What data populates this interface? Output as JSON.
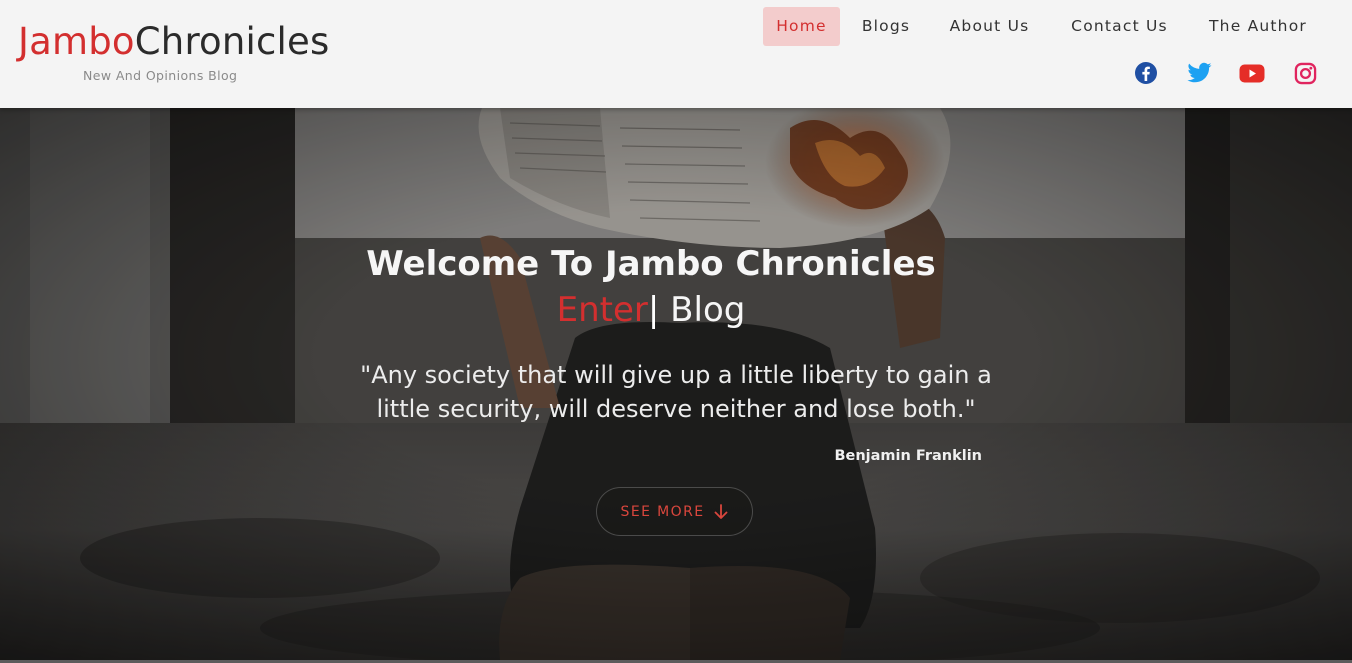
{
  "brand": {
    "name_part1": "Jambo",
    "name_part2": "Chronicles",
    "tagline": "New And Opinions Blog",
    "accent_color": "#d32f2f"
  },
  "nav": {
    "items": [
      {
        "label": "Home",
        "active": true
      },
      {
        "label": "Blogs",
        "active": false
      },
      {
        "label": "About Us",
        "active": false
      },
      {
        "label": "Contact Us",
        "active": false
      },
      {
        "label": "The Author",
        "active": false
      }
    ]
  },
  "social": [
    {
      "icon": "facebook-icon",
      "color": "#1f4fa3"
    },
    {
      "icon": "twitter-icon",
      "color": "#1da1f2"
    },
    {
      "icon": "youtube-icon",
      "color": "#e52d27"
    },
    {
      "icon": "instagram-icon",
      "color": "#e1306c"
    }
  ],
  "hero": {
    "title": "Welcome To Jambo Chronicles",
    "typed_word": "Enter",
    "typed_cursor": "|",
    "typed_rest": " Blog",
    "quote": "\"Any society that will give up a little liberty to gain a little security, will deserve neither and lose both.\"",
    "quote_author": "Benjamin Franklin",
    "cta_label": "SEE MORE",
    "cta_icon": "arrow-down-icon"
  }
}
